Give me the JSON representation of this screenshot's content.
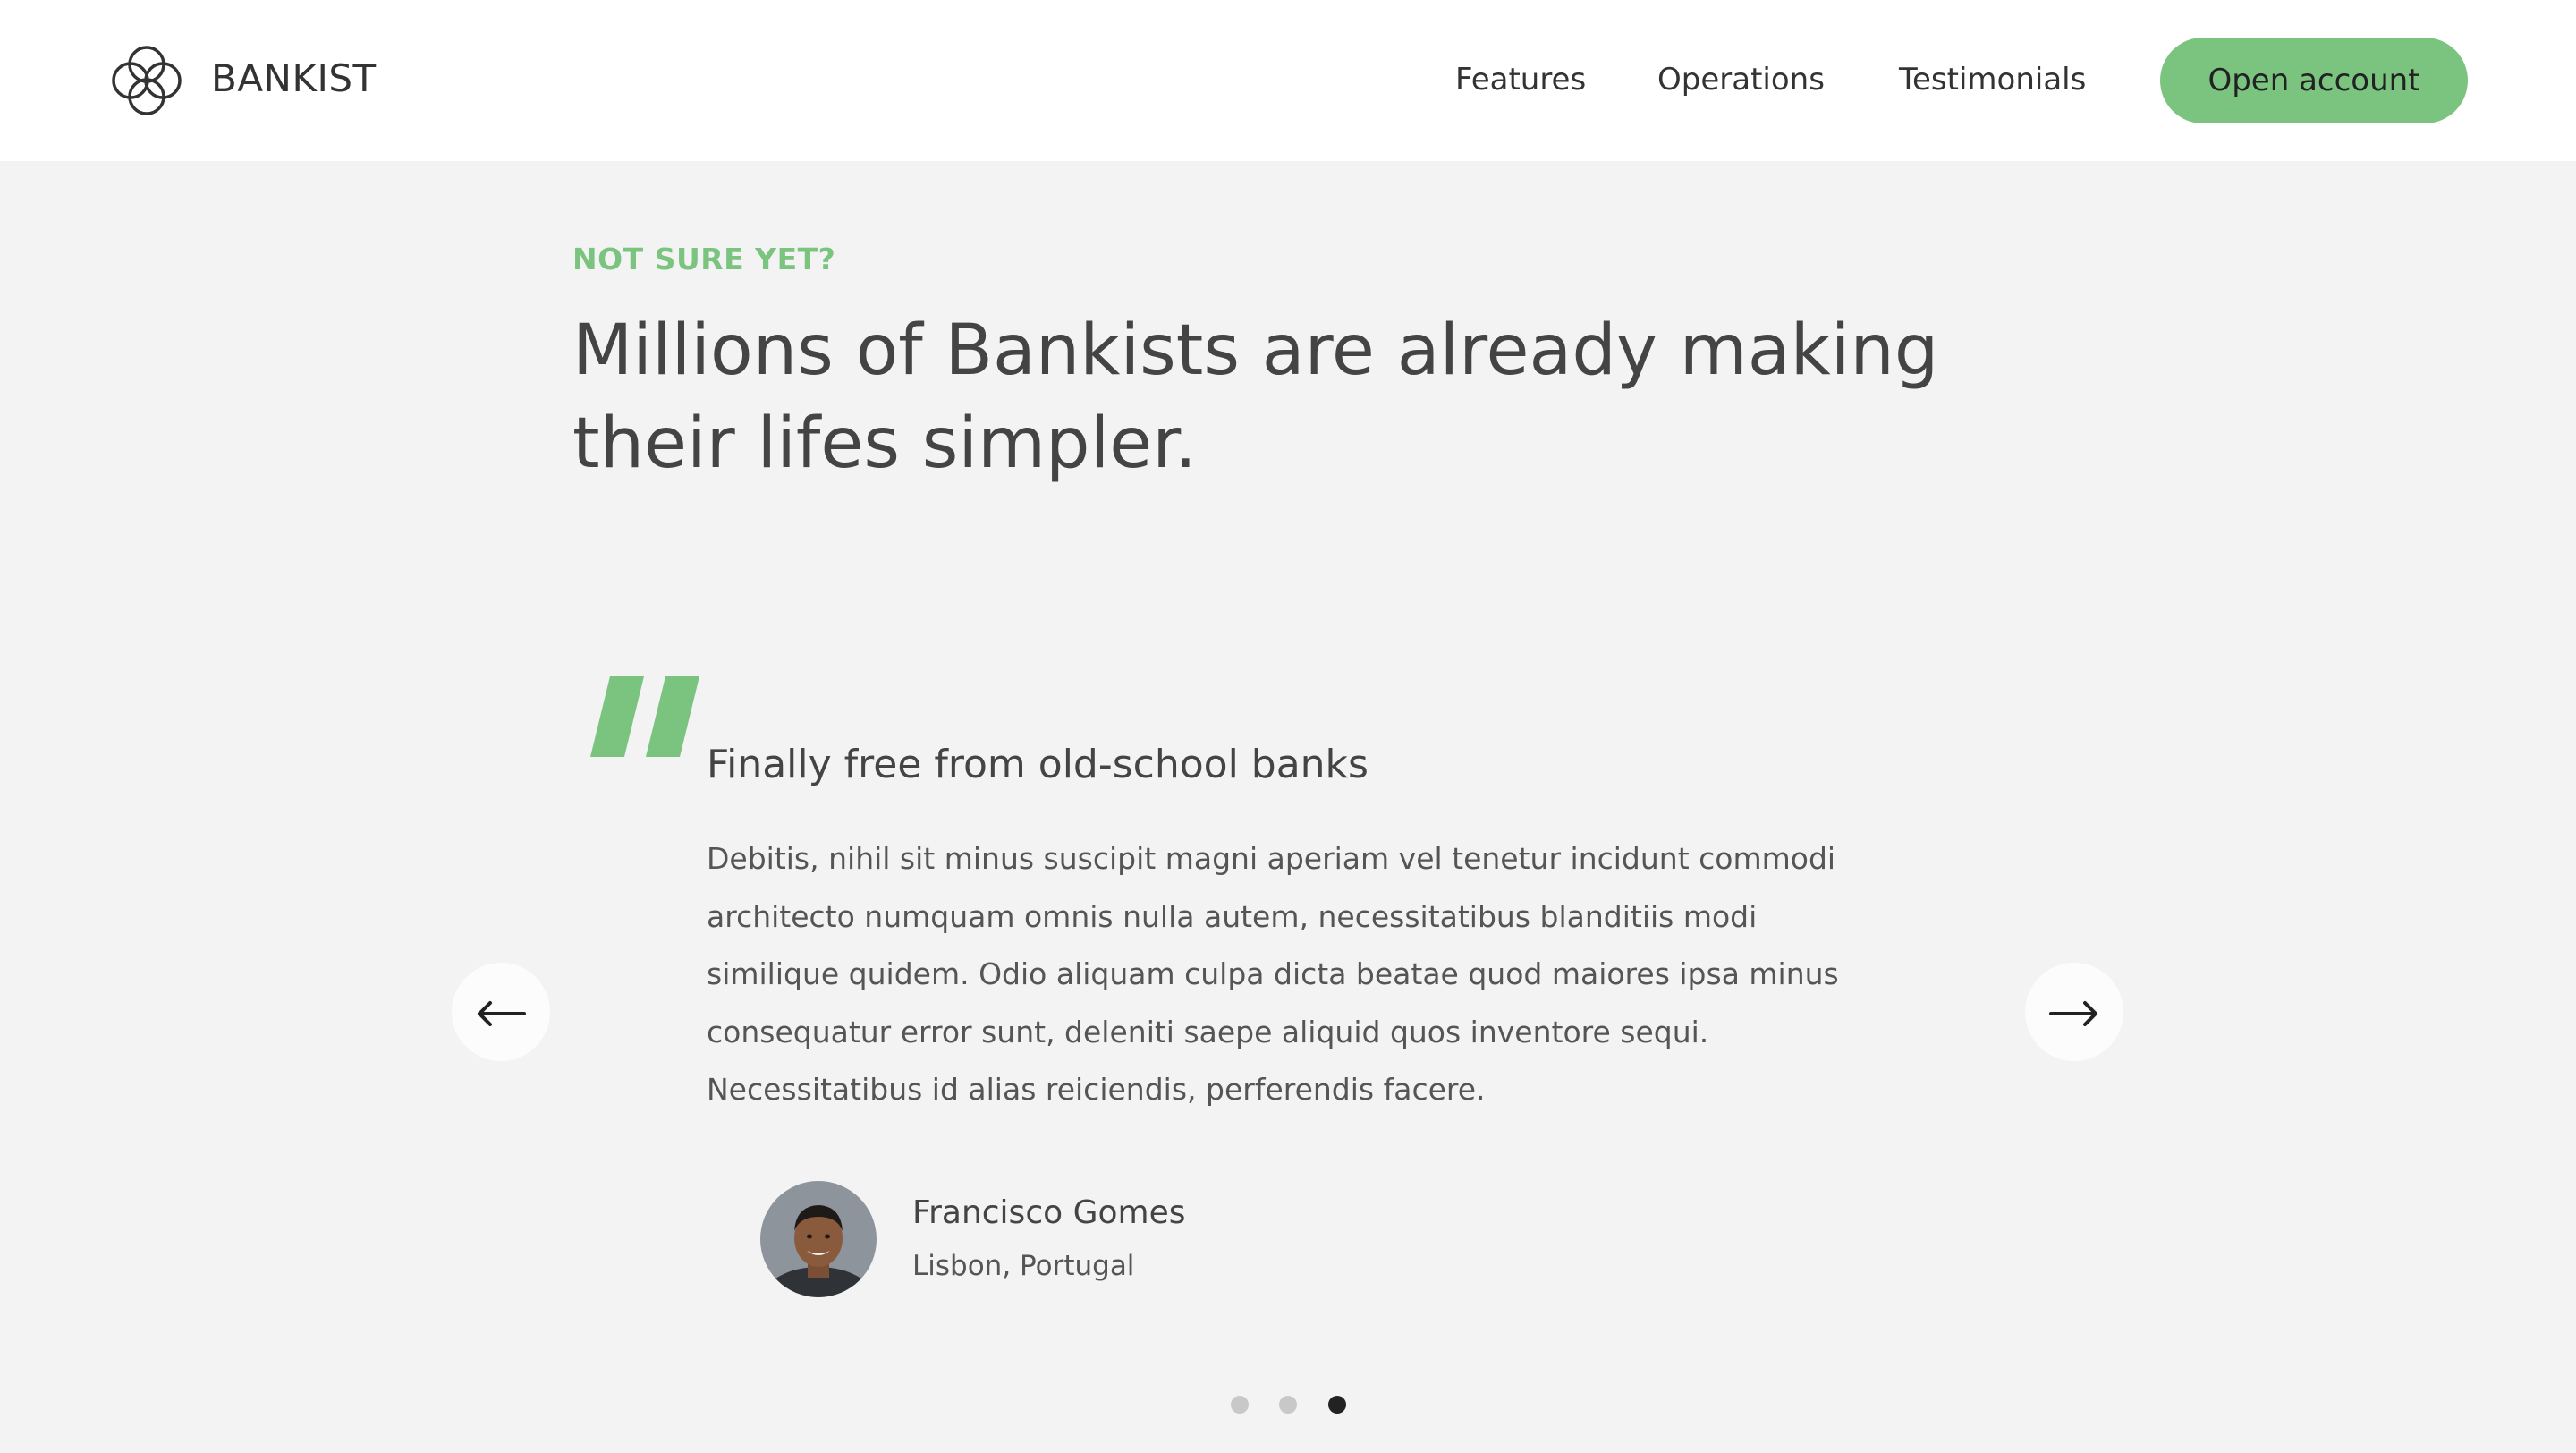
{
  "nav": {
    "brand": "BANKIST",
    "links": [
      "Features",
      "Operations",
      "Testimonials"
    ],
    "cta_label": "Open account",
    "cta_color": "#7bc47f"
  },
  "section": {
    "label": "NOT SURE YET?",
    "title": "Millions of Bankists are already making their lifes simpler."
  },
  "testimonial": {
    "heading": "Finally free from old-school banks",
    "text": "Debitis, nihil sit minus suscipit magni aperiam vel tenetur incidunt commodi architecto numquam omnis nulla autem, necessitatibus blanditiis modi similique quidem. Odio aliquam culpa dicta beatae quod maiores ipsa minus consequatur error sunt, deleniti saepe aliquid quos inventore sequi. Necessitatibus id alias reiciendis, perferendis facere.",
    "author_name": "Francisco Gomes",
    "author_location": "Lisbon, Portugal"
  },
  "slider": {
    "prev_icon": "arrow-left-icon",
    "next_icon": "arrow-right-icon",
    "total_slides": 3,
    "active_slide": 3
  },
  "colors": {
    "accent_green": "#7bc47f",
    "text_dark": "#444444",
    "background": "#f3f3f3",
    "dot_active": "#222222",
    "dot_inactive": "#c8c8c8"
  }
}
